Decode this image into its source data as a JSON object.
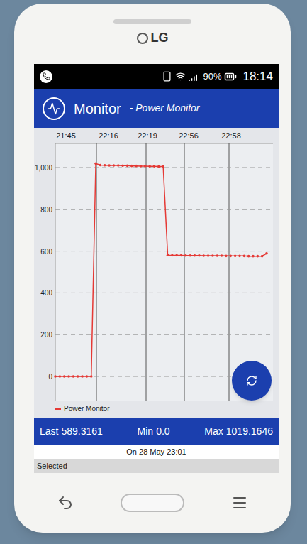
{
  "device": {
    "brand": "LG"
  },
  "status_bar": {
    "battery": "90%",
    "time": "18:14"
  },
  "app_bar": {
    "title": "Monitor",
    "subtitle": "- Power Monitor"
  },
  "chart": {
    "x_ticks": [
      "21:45",
      "22:16",
      "22:19",
      "22:56",
      "22:58"
    ],
    "y_ticks": [
      "1,000",
      "800",
      "600",
      "400",
      "200",
      "0"
    ],
    "series": [
      {
        "name": "Power Monitor",
        "color": "#e53935",
        "values": [
          0,
          0,
          0,
          0,
          0,
          0,
          0,
          0,
          0,
          1019.1646,
          1012,
          1011,
          1010,
          1010,
          1010,
          1009,
          1009,
          1008,
          1008,
          1007,
          1007,
          1006,
          1006,
          1005,
          1005,
          581,
          580,
          580,
          580,
          579,
          579,
          579,
          579,
          578,
          578,
          578,
          578,
          578,
          577,
          577,
          577,
          577,
          577,
          576,
          576,
          576,
          576,
          589.3161
        ]
      }
    ]
  },
  "stats": [
    {
      "label": "Last",
      "value": "589.3161"
    },
    {
      "label": "Min",
      "value": "0.0"
    },
    {
      "label": "Max",
      "value": "1019.1646"
    }
  ],
  "date": "On 28 May 23:01",
  "selection": {
    "label": "Selected",
    "value": "-"
  }
}
